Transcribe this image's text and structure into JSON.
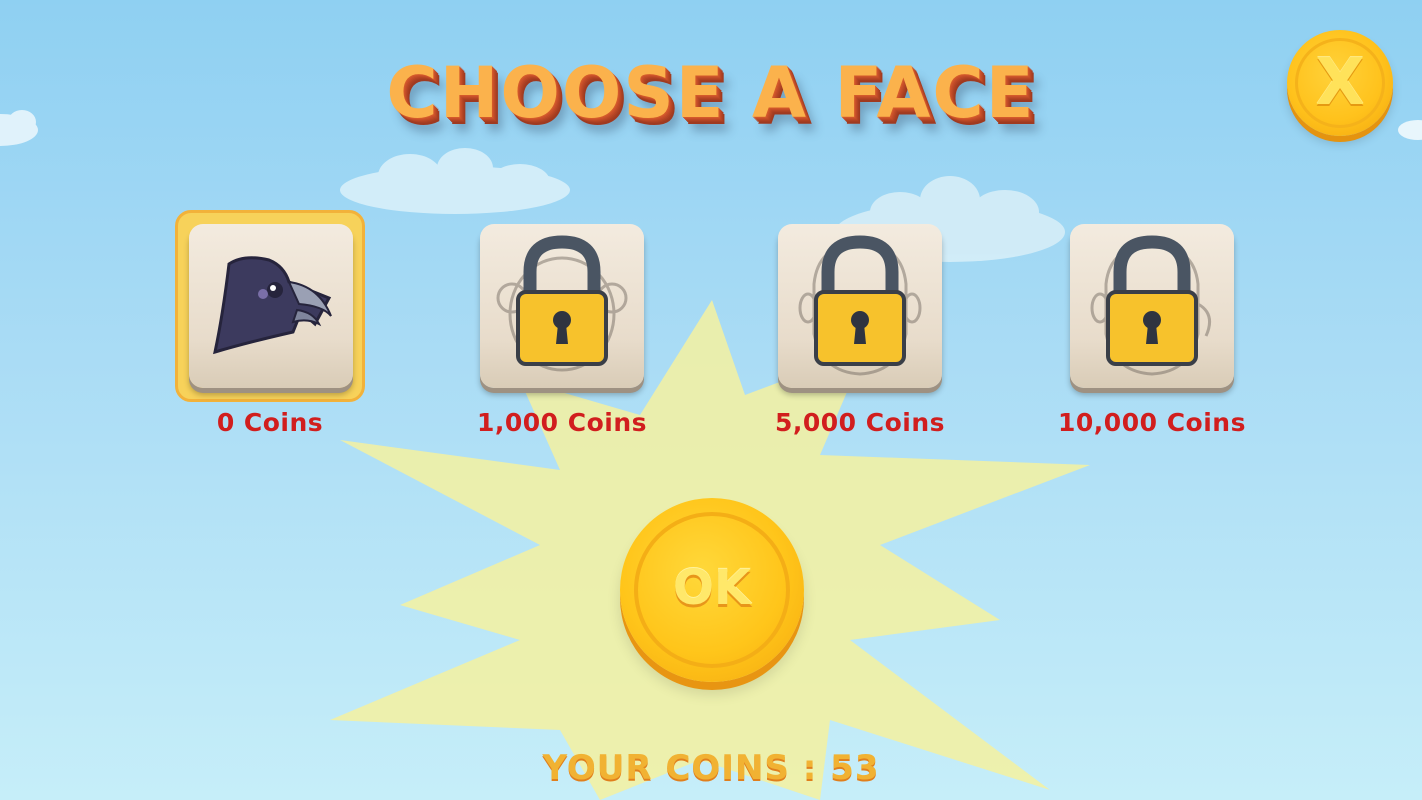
{
  "screen": {
    "title": "CHOOSE A FACE",
    "close_label": "X",
    "ok_label": "OK",
    "coins_label": "YOUR COINS : 53"
  },
  "faces": [
    {
      "id": "crow",
      "price": "0 Coins",
      "locked": false,
      "selected": true
    },
    {
      "id": "monkey",
      "price": "1,000 Coins",
      "locked": true,
      "selected": false
    },
    {
      "id": "man",
      "price": "5,000 Coins",
      "locked": true,
      "selected": false
    },
    {
      "id": "old-man",
      "price": "10,000 Coins",
      "locked": true,
      "selected": false
    }
  ],
  "colors": {
    "title": "#fbb24c",
    "price": "#d11e1e",
    "coin_gold": "#ffc21c",
    "lock_body": "#f7c22c",
    "lock_shackle": "#4a5563"
  },
  "icons": {
    "close": "close-icon",
    "lock": "padlock-icon",
    "crow": "crow-face-icon"
  }
}
